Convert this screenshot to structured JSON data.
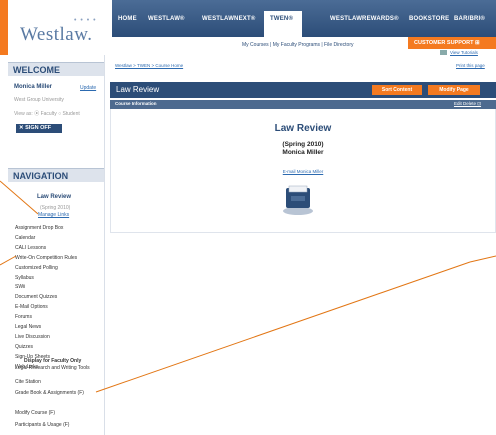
{
  "brand": {
    "logo": "Westlaw.",
    "logo_dots": "• • • •"
  },
  "topnav": {
    "items": [
      "HOME",
      "WESTLAW®",
      "WESTLAWNEXT®",
      "TWEN®",
      "WESTLAWREWARDS®",
      "BOOKSTORE",
      "BAR/BRI®"
    ]
  },
  "subnav": {
    "links": "My Courses  |  My Faculty Programs  |  File Directory",
    "customer_support": "CUSTOMER SUPPORT ⊞",
    "tutorials": "View Tutorials"
  },
  "welcome": {
    "heading": "WELCOME",
    "user": "Monica Miller",
    "update": "Update",
    "school": "West Group University",
    "view_as": "View as: ⦿ Faculty  ○ Student",
    "sign_off": "✕ SIGN OFF"
  },
  "navigation": {
    "heading": "NAVIGATION",
    "course_title": "Law Review",
    "term": "(Spring 2010)",
    "manage": "Manage Links",
    "items": [
      "Assignment Drop Box",
      "Calendar",
      "CALI Lessons",
      "Write-On Competition Rules",
      "Customized Polling",
      "Syllabus",
      "SWii",
      "Document Quizzes",
      "E-Mail Options",
      "Forums",
      "Legal News",
      "Live Discussion",
      "Quizzes",
      "Sign-Up Sheets",
      "Web Links"
    ],
    "faculty_heading": "Display for Faculty Only",
    "faculty_items": [
      "Legal Research and Writing Tools",
      "Cite Station",
      "Grade Book & Assignments (F)",
      "Modify Course (F)",
      "Participants & Usage (F)"
    ]
  },
  "main": {
    "breadcrumb": "Westlaw > TWEN > Course Home",
    "print": "Print this page",
    "title": "Law Review",
    "sort_btn": "Sort Content",
    "modify_btn": "Modify Page",
    "info_label": "Course Information",
    "info_actions": "Edit  Delete  ⊡",
    "course_title": "Law Review",
    "term": "(Spring 2010)",
    "instructor": "Monica Miller",
    "email": "E-mail Monica Miller"
  },
  "colors": {
    "accent": "#f47a20",
    "navy": "#2c4d78",
    "link": "#2c6ab0"
  }
}
